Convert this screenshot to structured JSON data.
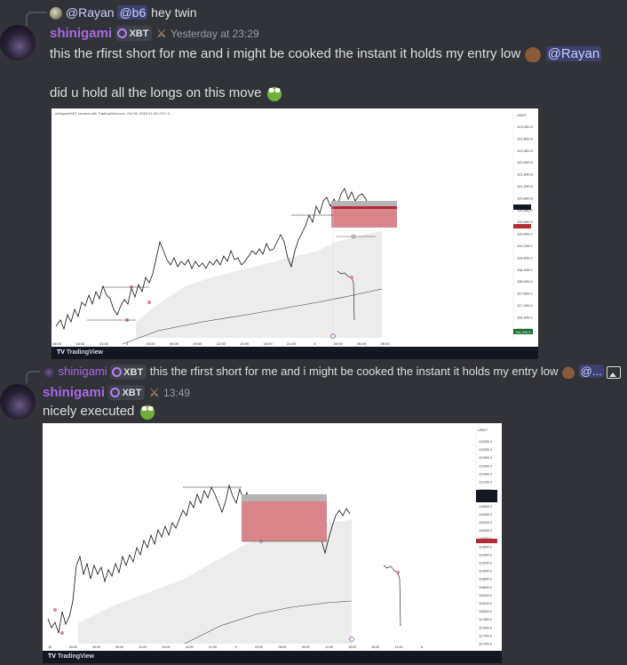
{
  "message1": {
    "reply": {
      "mention_user": "@Rayan",
      "mention_role": "@b6",
      "text": "hey twin"
    },
    "username": "shinigami",
    "tag": "XBT",
    "timestamp": "Yesterday at 23:29",
    "line1": "this the rfirst short for me and i might be cooked the instant it holds my entry low",
    "line1_mention": "@Rayan",
    "line2": "did u hold all the longs on this move",
    "chart": {
      "header": "shinigamiXBT created with TradingView.com, Oct 05, 2025 01:26 UTC+4",
      "footer": "TradingView",
      "currency": "USDT",
      "price_labels": [
        "123,200.0",
        "122,800.0",
        "122,400.0",
        "122,000.0",
        "121,600.0",
        "121,200.0",
        "120,800.0",
        "120,400.0",
        "120,000.0",
        "119,600.0",
        "119,200.0",
        "118,800.0",
        "118,400.0",
        "118,000.0",
        "117,600.0",
        "117,200.0",
        "116,800.0",
        "116,400.0"
      ],
      "time_labels": [
        "15:00",
        "18:00",
        "21:00",
        "4",
        "03:00",
        "06:00",
        "09:00",
        "12:00",
        "15:00",
        "18:00",
        "21:00",
        "5",
        "03:00",
        "06:00",
        "09:00"
      ],
      "last_price_badge": "116,340.0"
    }
  },
  "message2": {
    "reply": {
      "username": "shinigami",
      "tag": "XBT",
      "text": "this the rfirst short for me and i might be cooked the instant it holds my entry low",
      "mention": "@..."
    },
    "username": "shinigami",
    "tag": "XBT",
    "timestamp": "13:49",
    "text": "nicely executed",
    "chart": {
      "footer": "TradingView",
      "currency": "USDT",
      "price_labels": [
        "122200.0",
        "122000.0",
        "121800.0",
        "121600.0",
        "121400.0",
        "121200.0",
        "121000.0",
        "120800.0",
        "120600.0",
        "120400.0",
        "120200.0",
        "120000.0",
        "119800.0",
        "119600.0",
        "119400.0",
        "119200.0",
        "119000.0",
        "118800.0",
        "118600.0",
        "118400.0",
        "118200.0",
        "118000.0",
        "117800.0",
        "117600.0",
        "117400.0",
        "117200.0"
      ],
      "time_labels": [
        "18",
        "03:00",
        "06:00",
        "09:00",
        "12:00",
        "15:00",
        "18:00",
        "21:00",
        "5",
        "03:00",
        "06:00",
        "09:00",
        "12:00",
        "15:00",
        "18:00",
        "21:00",
        "6"
      ]
    }
  }
}
